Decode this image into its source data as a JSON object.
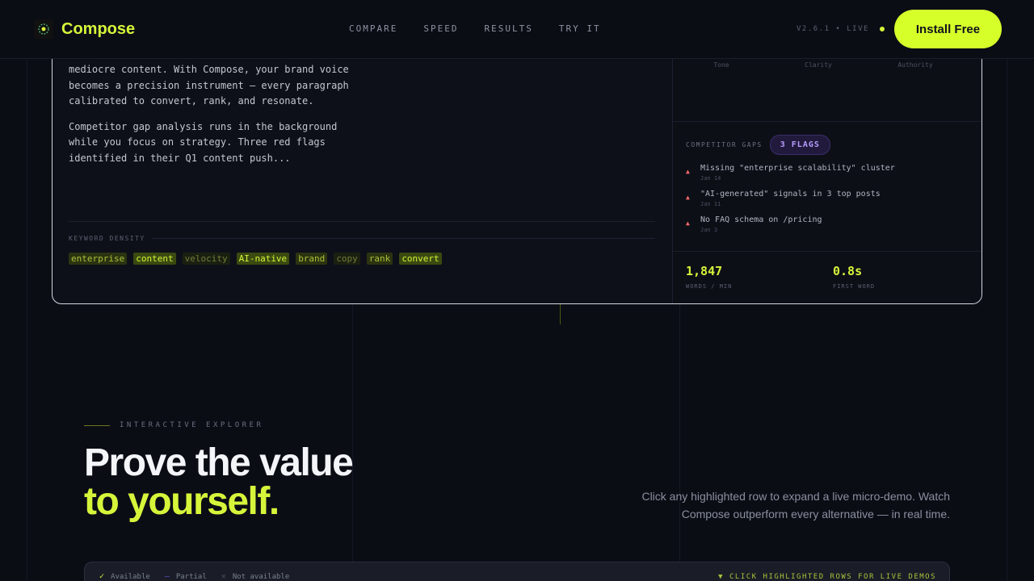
{
  "brand": {
    "name": "Compose"
  },
  "nav": {
    "links": [
      "COMPARE",
      "SPEED",
      "RESULTS",
      "TRY IT"
    ],
    "version": "V2.6.1 • LIVE",
    "cta": "Install Free"
  },
  "demo": {
    "paragraphs": [
      "mediocre content. With Compose, your brand voice\nbecomes a precision instrument — every paragraph\ncalibrated to convert, rank, and resonate.",
      "Competitor gap analysis runs in the background\nwhile you focus on strategy. Three red flags\nidentified in their Q1 content push..."
    ],
    "keyword_density": {
      "label": "KEYWORD DENSITY",
      "keywords": [
        {
          "text": "enterprise",
          "level": "mid"
        },
        {
          "text": "content",
          "level": "strong"
        },
        {
          "text": "velocity",
          "level": "weak"
        },
        {
          "text": "AI-native",
          "level": "strong"
        },
        {
          "text": "brand",
          "level": "mid"
        },
        {
          "text": "copy",
          "level": "weak"
        },
        {
          "text": "rank",
          "level": "mid"
        },
        {
          "text": "convert",
          "level": "strong"
        }
      ]
    },
    "scores": {
      "labels": [
        "Tone",
        "Clarity",
        "Authority"
      ]
    },
    "gaps": {
      "label": "COMPETITOR GAPS",
      "badge": "3 FLAGS",
      "items": [
        {
          "title": "Missing \"enterprise scalability\" cluster",
          "date": "Jan 14"
        },
        {
          "title": "\"AI-generated\" signals in 3 top posts",
          "date": "Jan 11"
        },
        {
          "title": "No FAQ schema on /pricing",
          "date": "Jan 3"
        }
      ]
    },
    "stats": [
      {
        "value": "1,847",
        "label": "WORDS / MIN"
      },
      {
        "value": "0.8s",
        "label": "FIRST WORD"
      }
    ]
  },
  "explorer": {
    "eyebrow": "INTERACTIVE EXPLORER",
    "headline_line1": "Prove the value",
    "headline_line2": "to yourself.",
    "subtitle": "Click any highlighted row to expand a live micro-demo. Watch Compose outperform every alternative — in real time.",
    "legend": {
      "available": "Available",
      "partial": "Partial",
      "not_available": "Not available",
      "hint": "▼ CLICK HIGHLIGHTED ROWS FOR LIVE DEMOS"
    }
  },
  "colors": {
    "accent": "#d6f53a",
    "flag": "#b79cff",
    "warn": "#ff6b6b",
    "background": "#0b0d15"
  }
}
